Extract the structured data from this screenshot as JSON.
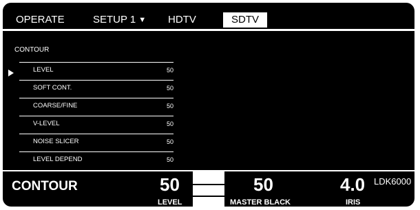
{
  "tabs": [
    {
      "label": "OPERATE"
    },
    {
      "label": "SETUP 1",
      "arrow": "▼"
    },
    {
      "label": "HDTV"
    },
    {
      "label": "SDTV",
      "active": true
    }
  ],
  "menu": {
    "title": "CONTOUR",
    "cursor_icon": "triangle-right-icon",
    "items": [
      {
        "label": "LEVEL",
        "value": "50"
      },
      {
        "label": "SOFT CONT.",
        "value": "50"
      },
      {
        "label": "COARSE/FINE",
        "value": "50"
      },
      {
        "label": "V-LEVEL",
        "value": "50"
      },
      {
        "label": "NOISE SLICER",
        "value": "50"
      },
      {
        "label": "LEVEL DEPEND",
        "value": "50"
      }
    ]
  },
  "status": {
    "function_name": "CONTOUR",
    "level_value": "50",
    "level_label": "LEVEL",
    "master_black_value": "50",
    "master_black_label": "MASTER BLACK",
    "iris_value": "4.0",
    "iris_label": "IRIS",
    "model": "LDK6000"
  },
  "colors": {
    "background": "#000000",
    "foreground": "#ffffff"
  }
}
